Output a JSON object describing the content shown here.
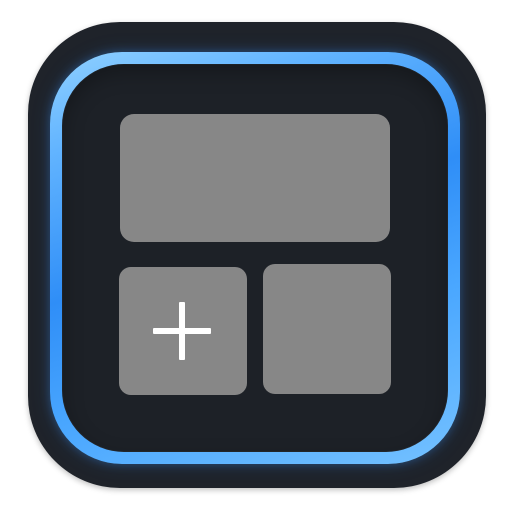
{
  "icon": {
    "name": "widget-grid-app-icon",
    "colors": {
      "outer_tile": "#1f232a",
      "inner_tile": "#1d2127",
      "ring_start": "#8fd0ff",
      "ring_mid": "#2f8ef7",
      "ring_end": "#74c1ff",
      "widget_fill": "#878787",
      "plus_symbol": "#ffffff"
    },
    "symbols": {
      "add": "plus-icon"
    }
  }
}
